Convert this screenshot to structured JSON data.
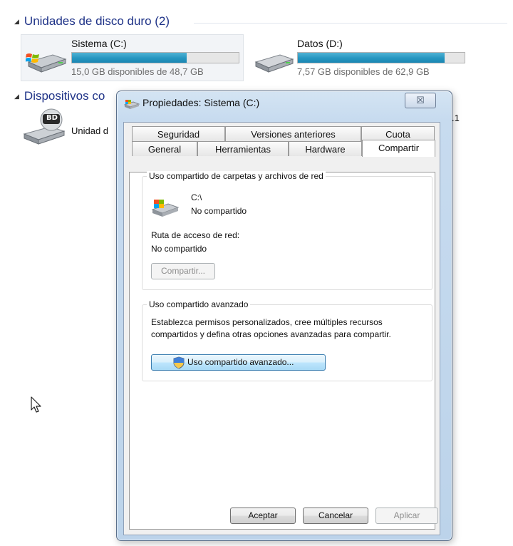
{
  "explorer": {
    "hdd_group": {
      "title": "Unidades de disco duro (2)"
    },
    "devices_group": {
      "title_visible": "Dispositivos co"
    },
    "drives": [
      {
        "name": "Sistema (C:)",
        "free_text": "15,0 GB disponibles de 48,7 GB",
        "used_fraction": 0.69,
        "selected": true
      },
      {
        "name": "Datos (D:)",
        "free_text": "7,57 GB disponibles de 62,9 GB",
        "used_fraction": 0.88,
        "selected": false
      }
    ],
    "optical_drive": {
      "name_visible": "Unidad d",
      "badge": "BD"
    },
    "edge_fragment": ".1"
  },
  "dialog": {
    "title": "Propiedades: Sistema (C:)",
    "close_glyph": "☒",
    "tabs_back": [
      "Seguridad",
      "Versiones anteriores",
      "Cuota"
    ],
    "tabs_front": [
      "General",
      "Herramientas",
      "Hardware",
      "Compartir"
    ],
    "active_tab": "Compartir",
    "network_group": {
      "label": "Uso compartido de carpetas y archivos de red",
      "path": "C:\\",
      "status": "No compartido",
      "net_path_label": "Ruta de acceso de red:",
      "net_path_value": "No compartido",
      "share_button": "Compartir..."
    },
    "advanced_group": {
      "label": "Uso compartido avanzado",
      "description_line1": "Establezca permisos personalizados, cree múltiples recursos",
      "description_line2": "compartidos y defina otras opciones avanzadas para compartir.",
      "button": "Uso compartido avanzado..."
    },
    "buttons": {
      "ok": "Aceptar",
      "cancel": "Cancelar",
      "apply": "Aplicar"
    }
  },
  "icons": [
    "collapse-triangle-icon",
    "hard-drive-icon",
    "windows-logo-icon",
    "bluray-drive-icon",
    "uac-shield-icon",
    "mouse-cursor-icon"
  ]
}
